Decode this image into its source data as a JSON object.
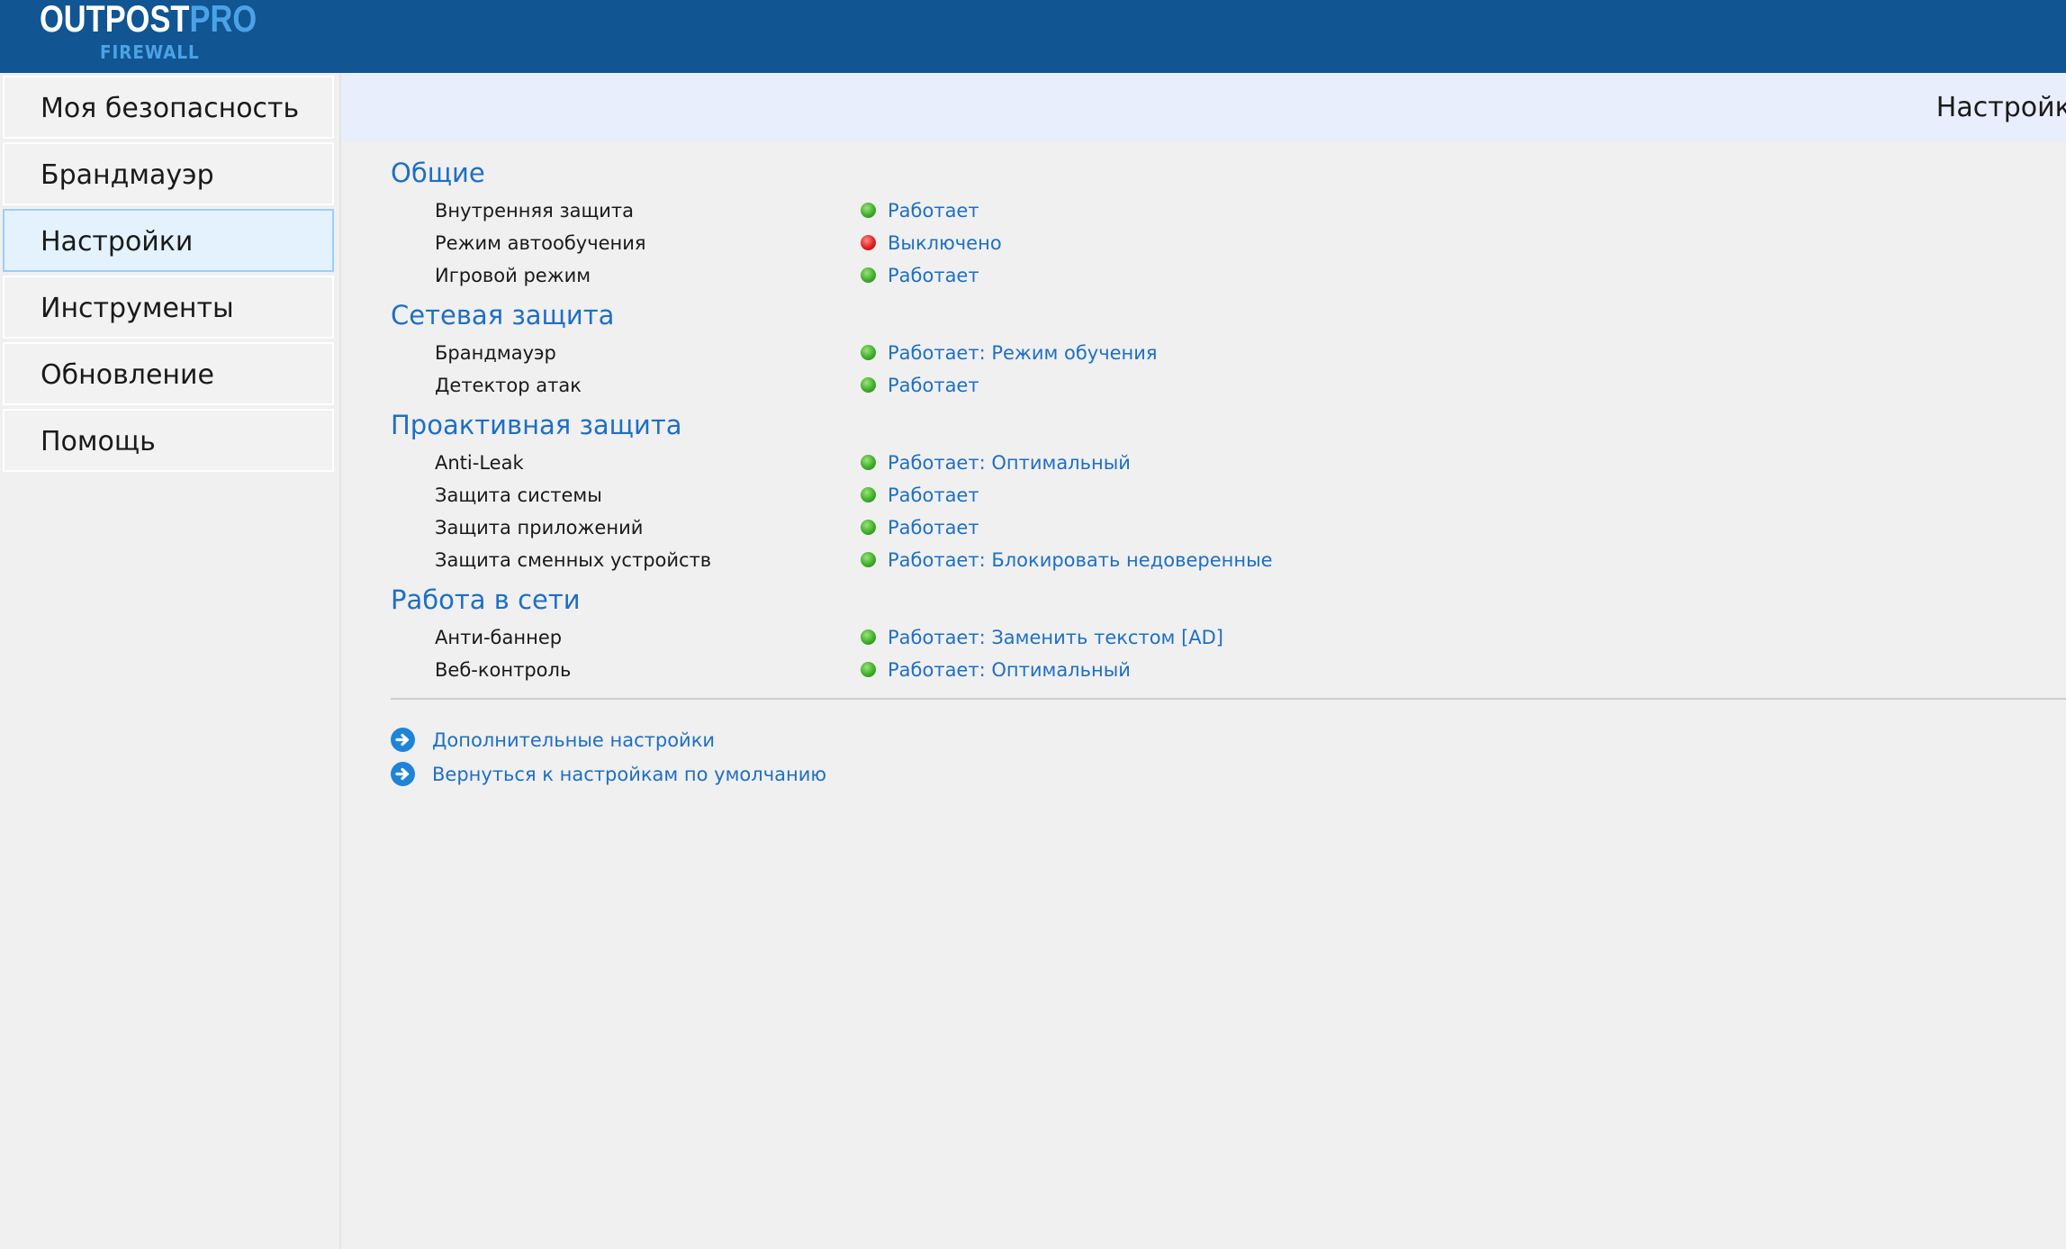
{
  "header": {
    "logo_main_white": "OUTPOST",
    "logo_main_blue": "PRO",
    "logo_sub": "FIREWALL"
  },
  "sidebar": {
    "items": [
      {
        "label": "Моя безопасность"
      },
      {
        "label": "Брандмауэр"
      },
      {
        "label": "Настройки",
        "active": true
      },
      {
        "label": "Инструменты"
      },
      {
        "label": "Обновление"
      },
      {
        "label": "Помощь"
      }
    ]
  },
  "main": {
    "title": "Настройки",
    "sections": [
      {
        "heading": "Общие",
        "rows": [
          {
            "label": "Внутренняя защита",
            "status": "Работает",
            "state": "green"
          },
          {
            "label": "Режим автообучения",
            "status": "Выключено",
            "state": "red"
          },
          {
            "label": "Игровой режим",
            "status": "Работает",
            "state": "green"
          }
        ]
      },
      {
        "heading": "Сетевая защита",
        "rows": [
          {
            "label": "Брандмауэр",
            "status": "Работает: Режим обучения",
            "state": "green"
          },
          {
            "label": "Детектор атак",
            "status": "Работает",
            "state": "green"
          }
        ]
      },
      {
        "heading": "Проактивная защита",
        "rows": [
          {
            "label": "Anti-Leak",
            "status": "Работает: Оптимальный",
            "state": "green"
          },
          {
            "label": "Защита системы",
            "status": "Работает",
            "state": "green"
          },
          {
            "label": "Защита приложений",
            "status": "Работает",
            "state": "green"
          },
          {
            "label": "Защита сменных устройств",
            "status": "Работает: Блокировать недоверенные",
            "state": "green"
          }
        ]
      },
      {
        "heading": "Работа в сети",
        "rows": [
          {
            "label": "Анти-баннер",
            "status": "Работает: Заменить текстом [AD]",
            "state": "green"
          },
          {
            "label": "Веб-контроль",
            "status": "Работает: Оптимальный",
            "state": "green"
          }
        ]
      }
    ],
    "links": [
      {
        "label": "Дополнительные настройки",
        "icon": "arrow-right-circle-icon"
      },
      {
        "label": "Вернуться к настройкам по умолчанию",
        "icon": "arrow-right-circle-icon"
      }
    ]
  },
  "colors": {
    "header_bg": "#115592",
    "accent_blue": "#1e6fc4",
    "status_green": "#3fae2a",
    "status_red": "#e02020",
    "active_nav_bg": "#e4f2fe"
  }
}
